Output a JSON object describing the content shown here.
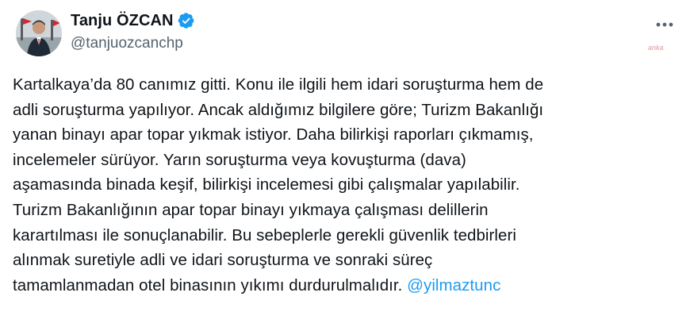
{
  "author": {
    "display_name": "Tanju ÖZCAN",
    "handle": "@tanjuozcanchp",
    "verified": true,
    "verified_color": "#1d9bf0"
  },
  "icons": {
    "more": "more-horizontal-icon",
    "verified": "verified-badge-icon"
  },
  "watermark": "anka",
  "tweet": {
    "lines": [
      "Kartalkaya’da 80 canımız gitti. Konu ile ilgili hem idari soruşturma hem de",
      "adli soruşturma yapılıyor. Ancak aldığımız bilgilere göre; Turizm Bakanlığı",
      "yanan binayı apar topar yıkmak istiyor. Daha bilirkişi raporları çıkmamış,",
      "incelemeler sürüyor. Yarın soruşturma veya kovuşturma (dava)",
      "aşamasında binada keşif, bilirkişi incelemesi gibi çalışmalar yapılabilir.",
      "Turizm Bakanlığının apar topar binayı yıkmaya çalışması delillerin",
      "karartılması ile sonuçlanabilir. Bu sebeplerle gerekli güvenlik tedbirleri",
      "alınmak suretiyle adli ve idari soruşturma ve sonraki süreç"
    ],
    "last_line": "tamamlanmadan otel binasının yıkımı durdurulmalıdır. ",
    "mention": "@yilmaztunc",
    "mention_color": "#1d9bf0"
  }
}
